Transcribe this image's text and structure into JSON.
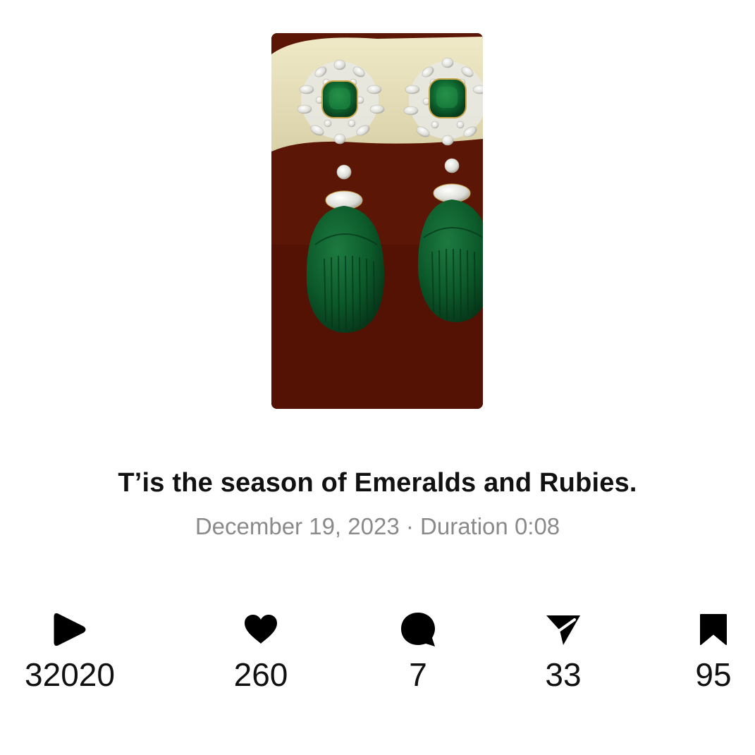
{
  "post": {
    "title": "T’is the season of Emeralds and Rubies.",
    "date": "December 19, 2023",
    "separator": "·",
    "duration_label": "Duration",
    "duration": "0:08"
  },
  "stats": {
    "plays": {
      "icon": "play-icon",
      "count": "32020"
    },
    "likes": {
      "icon": "heart-icon",
      "count": "260"
    },
    "comments": {
      "icon": "comment-icon",
      "count": "7"
    },
    "shares": {
      "icon": "share-icon",
      "count": "33"
    },
    "saves": {
      "icon": "bookmark-icon",
      "count": "95"
    }
  },
  "colors": {
    "text": "#111111",
    "muted": "#8a8a8a",
    "thumb_bg": "#5a1404",
    "emerald": "#0f5a2c"
  }
}
